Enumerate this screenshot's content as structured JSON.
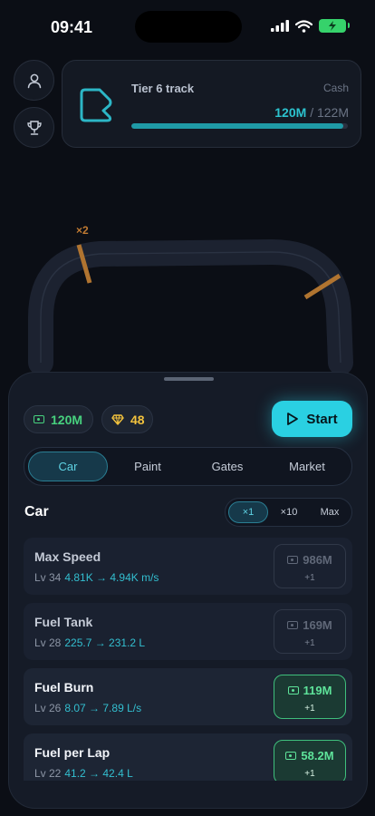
{
  "status": {
    "time": "09:41"
  },
  "track": {
    "title": "Tier 6 track",
    "cash_label": "Cash",
    "cash_current": "120M",
    "cash_separator": "/",
    "cash_target": "122M",
    "progress": 0.98,
    "multiplier_label": "×2"
  },
  "wallet": {
    "cash": "120M",
    "gems": "48"
  },
  "start_label": "Start",
  "tabs": [
    {
      "label": "Car",
      "active": true
    },
    {
      "label": "Paint",
      "active": false
    },
    {
      "label": "Gates",
      "active": false
    },
    {
      "label": "Market",
      "active": false
    }
  ],
  "section": {
    "title": "Car"
  },
  "multipliers": [
    {
      "label": "×1",
      "active": true
    },
    {
      "label": "×10",
      "active": false
    },
    {
      "label": "Max",
      "active": false
    }
  ],
  "upgrades": [
    {
      "name": "Max Speed",
      "level": "Lv 34",
      "change": "4.81K → 4.94K m/s",
      "cost": "986M",
      "step": "+1",
      "affordable": false
    },
    {
      "name": "Fuel Tank",
      "level": "Lv 28",
      "change": "225.7 → 231.2 L",
      "cost": "169M",
      "step": "+1",
      "affordable": false
    },
    {
      "name": "Fuel Burn",
      "level": "Lv 26",
      "change": "8.07 → 7.89 L/s",
      "cost": "119M",
      "step": "+1",
      "affordable": true
    },
    {
      "name": "Fuel per Lap",
      "level": "Lv 22",
      "change": "41.2 → 42.4 L",
      "cost": "58.2M",
      "step": "+1",
      "affordable": true
    }
  ],
  "colors": {
    "accent": "#2ad0e2",
    "cash": "#47d17e",
    "gem": "#f2c23d",
    "track_gate": "#b07430"
  }
}
